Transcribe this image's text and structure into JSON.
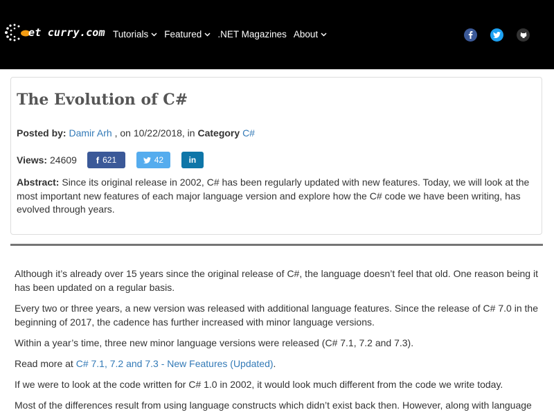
{
  "header": {
    "logo_text": "et curry.com",
    "nav": [
      {
        "label": "Tutorials",
        "has_dropdown": true
      },
      {
        "label": "Featured",
        "has_dropdown": true
      },
      {
        "label": ".NET Magazines",
        "has_dropdown": false
      },
      {
        "label": "About",
        "has_dropdown": true
      }
    ],
    "social": [
      {
        "icon": "facebook-icon",
        "glyph": "f",
        "color": "#3b5998"
      },
      {
        "icon": "twitter-icon",
        "glyph": "t",
        "color": "#1da1f2"
      },
      {
        "icon": "github-icon",
        "glyph": "g",
        "color": "#333333"
      }
    ]
  },
  "article": {
    "title": "The Evolution of C#",
    "posted_by_label": "Posted by:",
    "author": "Damir Arh",
    "on_text": ", on 10/22/2018, in",
    "category_label": "Category",
    "category": "C#",
    "views_label": "Views:",
    "views": "24609",
    "share": {
      "facebook_count": "621",
      "twitter_count": "42"
    },
    "abstract_label": "Abstract:",
    "abstract": "Since its original release in 2002, C# has been regularly updated with new features. Today, we will look at the most important new features of each major language version and explore how the C# code we have been writing, has evolved through years."
  },
  "body": {
    "p1": "Although it’s already over 15 years since the original release of C#, the language doesn’t feel that old. One reason being it has been updated on a regular basis.",
    "p2": "Every two or three years, a new version was released with additional language features. Since the release of C# 7.0 in the beginning of 2017, the cadence has further increased with minor language versions.",
    "p3": "Within a year’s time, three new minor language versions were released (C# 7.1, 7.2 and 7.3).",
    "p4_prefix": "Read more at",
    "p4_link": "C# 7.1, 7.2 and 7.3 - New Features (Updated)",
    "p4_suffix": ".",
    "p5": "If we were to look at the code written for C# 1.0 in 2002, it would look much different from the code we write today.",
    "p6": "Most of the differences result from using language constructs which didn’t exist back then. However, along with language"
  },
  "colors": {
    "header_bg": "#000000",
    "link": "#337ab7",
    "facebook": "#3b5998",
    "twitter": "#55acee",
    "linkedin": "#0e76a8"
  }
}
